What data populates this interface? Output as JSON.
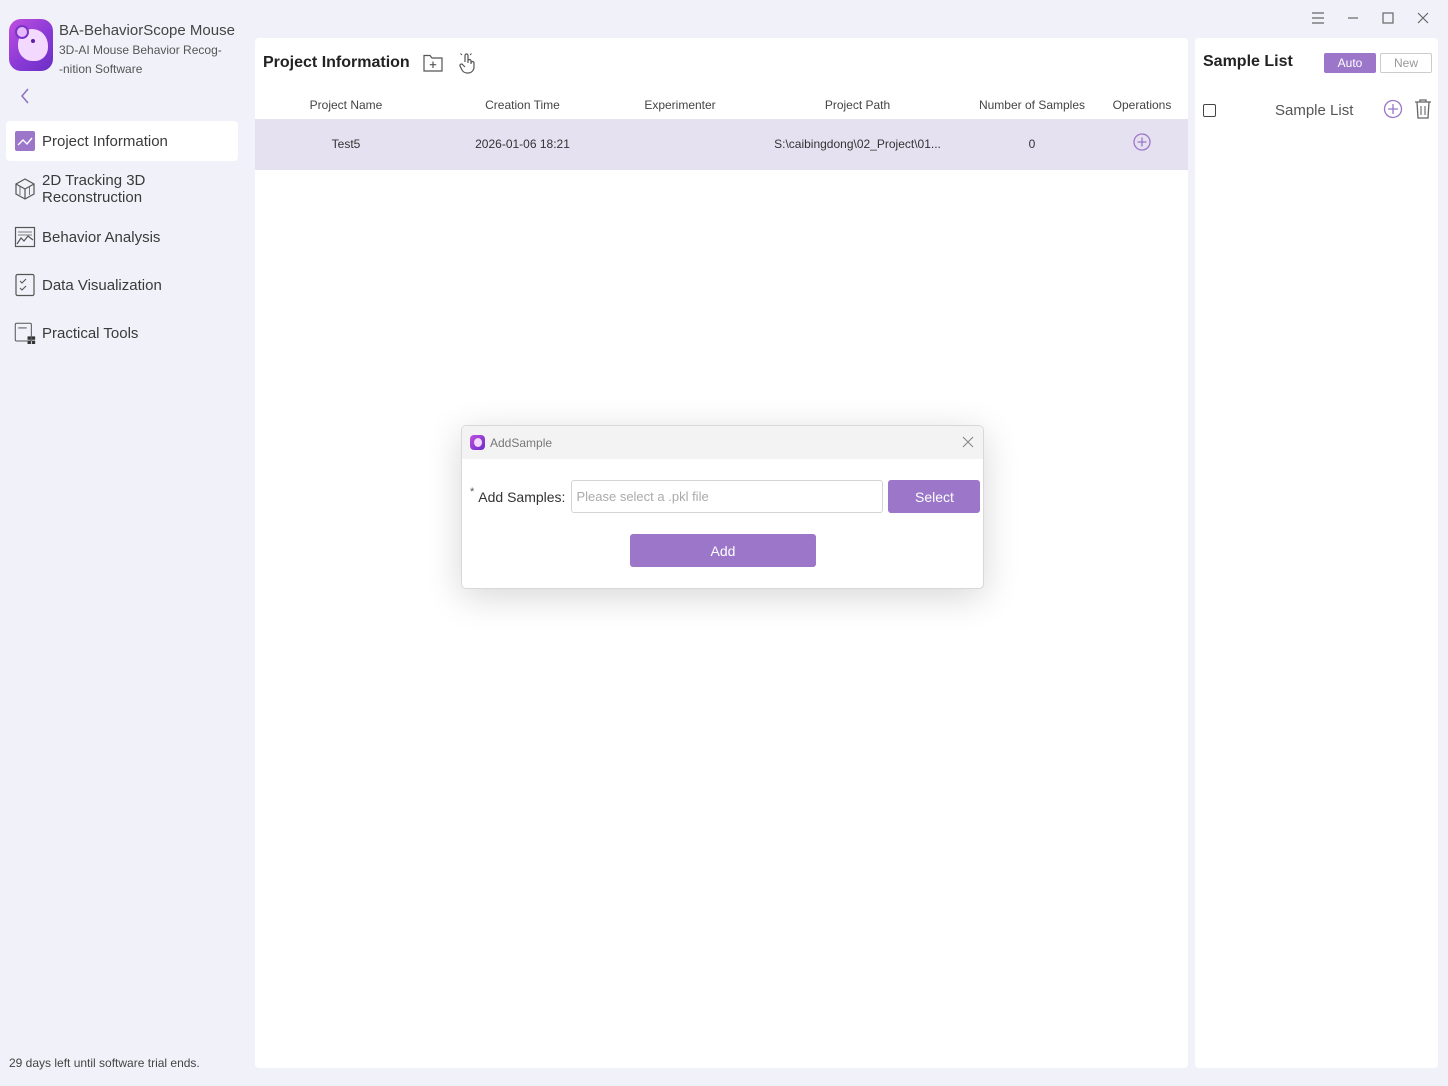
{
  "brand": {
    "title": "BA-BehaviorScope Mouse",
    "subtitle_line1": "3D-AI Mouse Behavior Recog-",
    "subtitle_line2": "-nition Software"
  },
  "sidebar": {
    "items": [
      {
        "label": "Project Information",
        "icon": "chart-area-icon",
        "active": true
      },
      {
        "label": "2D Tracking 3D Reconstruction",
        "icon": "cube-icon",
        "active": false
      },
      {
        "label": "Behavior Analysis",
        "icon": "line-chart-icon",
        "active": false
      },
      {
        "label": "Data Visualization",
        "icon": "checklist-icon",
        "active": false
      },
      {
        "label": "Practical Tools",
        "icon": "tools-grid-icon",
        "active": false
      }
    ],
    "trial_notice": "29 days left until software trial ends."
  },
  "main": {
    "title": "Project Information",
    "table": {
      "columns": [
        "Project Name",
        "Creation Time",
        "Experimenter",
        "Project Path",
        "Number of Samples",
        "Operations"
      ],
      "rows": [
        {
          "project_name": "Test5",
          "creation_time": "2026-01-06 18:21",
          "experimenter": "",
          "project_path": "S:\\caibingdong\\02_Project\\01...",
          "num_samples": "0"
        }
      ]
    }
  },
  "right_panel": {
    "title": "Sample List",
    "mode_auto": "Auto",
    "mode_new": "New",
    "list_label": "Sample List"
  },
  "modal": {
    "title": "AddSample",
    "required_mark": "*",
    "field_label": "Add Samples:",
    "input_value": "",
    "input_placeholder": "Please select a .pkl file",
    "select_label": "Select",
    "add_label": "Add"
  },
  "colors": {
    "accent": "#9b76c9",
    "selected_row": "#e6e1f1",
    "app_background": "#f1f2f9",
    "nav_icon": "#8e6cc0"
  }
}
